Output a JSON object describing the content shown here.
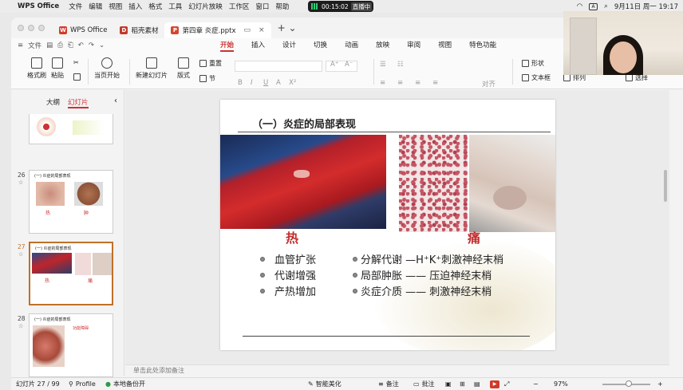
{
  "mac_menu": {
    "app_name": "WPS Office",
    "items": [
      "文件",
      "编辑",
      "视图",
      "插入",
      "格式",
      "工具",
      "幻灯片放映",
      "工作区",
      "窗口",
      "帮助"
    ],
    "recording_time": "00:15:02",
    "live_label": "直播中",
    "date_time": "9月11日 周一 19:17",
    "input_icon": "A"
  },
  "tabs": [
    {
      "label": "WPS Office",
      "color": "#d23a2a",
      "icon": "W"
    },
    {
      "label": "稻壳素材",
      "color": "#c0392b",
      "icon": "D"
    },
    {
      "label": "第四章 炎症.pptx",
      "color": "#d4472e",
      "icon": "P"
    }
  ],
  "ribbon_top": {
    "file_label": "文件",
    "tabs": [
      "开始",
      "插入",
      "设计",
      "切换",
      "动画",
      "放映",
      "审阅",
      "视图",
      "特色功能"
    ],
    "active_tab": "开始"
  },
  "ribbon": {
    "format_painter": "格式刷",
    "paste": "粘贴",
    "start_from_current": "当页开始",
    "new_slide": "新建幻灯片",
    "layout": "版式",
    "section": "节",
    "reset": "重置",
    "shape": "形状",
    "textbox": "文本框",
    "arrange": "排列",
    "select": "选择",
    "align": "对齐"
  },
  "left_panel": {
    "tab_outline": "大纲",
    "tab_slides": "幻灯片",
    "thumbs": [
      {
        "num": "26",
        "title": "(一) 炎症的局部表现",
        "labels": [
          "热",
          "肿"
        ]
      },
      {
        "num": "27",
        "title": "(一) 炎症的局部表现",
        "labels": [
          "热",
          "痛"
        ]
      },
      {
        "num": "28",
        "title": "(一) 炎症的局部表现",
        "labels": [
          "功能障碍"
        ]
      }
    ]
  },
  "slide": {
    "title": "（一）炎症的局部表现",
    "heading_heat": "热",
    "heading_pain": "痛",
    "heat_points": [
      "血管扩张",
      "代谢增强",
      "产热增加"
    ],
    "pain_points": [
      "分解代谢 —H⁺K⁺刺激神经末梢",
      "局部肿胀 —— 压迫神经末梢",
      "炎症介质 ——  刺激神经末梢"
    ]
  },
  "notes_placeholder": "单击此处添加备注",
  "status": {
    "slide_counter": "幻灯片 27 / 99",
    "profile": "Profile",
    "backup": "本地备份开",
    "smart_beautify": "智能美化",
    "notes": "备注",
    "comments": "批注",
    "zoom": "97%"
  }
}
